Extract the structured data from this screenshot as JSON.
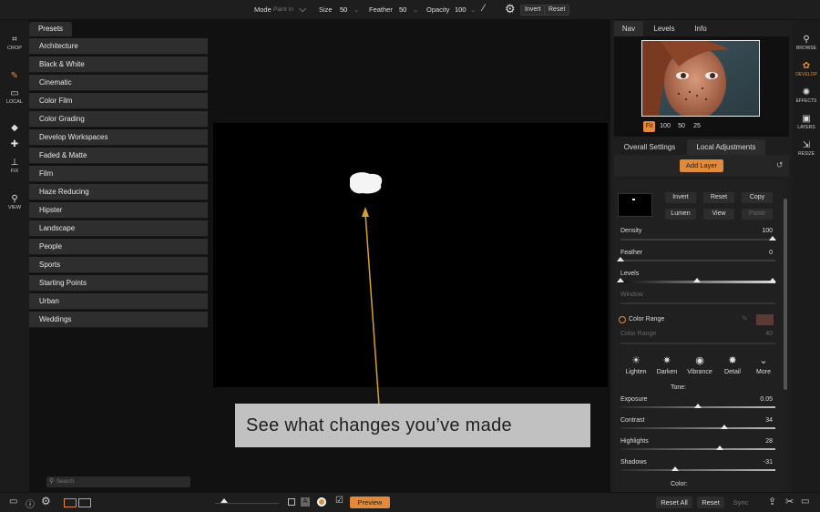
{
  "topbar": {
    "mode_label": "Mode",
    "mode_value": "Paint In",
    "size_label": "Size",
    "size_value": "50",
    "feather_label": "Feather",
    "feather_value": "50",
    "opacity_label": "Opacity",
    "opacity_value": "100",
    "invert_label": "Invert",
    "reset_label": "Reset"
  },
  "lefttools": [
    {
      "label": "CROP",
      "icon": "crop-icon",
      "glyph": "⌗"
    },
    {
      "label": "",
      "icon": "brush-icon",
      "glyph": "✎"
    },
    {
      "label": "LOCAL",
      "icon": "local-icon",
      "glyph": "▭"
    },
    {
      "label": "",
      "icon": "eraser-icon",
      "glyph": "◆"
    },
    {
      "label": "",
      "icon": "heal-icon",
      "glyph": "✚"
    },
    {
      "label": "FIX",
      "icon": "stamp-icon",
      "glyph": "⊥"
    },
    {
      "label": "VIEW",
      "icon": "magnifier-icon",
      "glyph": "⚲"
    }
  ],
  "presets": {
    "tab_label": "Presets",
    "items": [
      "Architecture",
      "Black & White",
      "Cinematic",
      "Color Film",
      "Color Grading",
      "Develop Workspaces",
      "Faded & Matte",
      "Film",
      "Haze Reducing",
      "Hipster",
      "Landscape",
      "People",
      "Sports",
      "Starting Points",
      "Urban",
      "Weddings"
    ],
    "search_placeholder": "Search"
  },
  "canvas": {
    "banner_text": "See what changes you’ve made",
    "arrow_color": "#d7a12a"
  },
  "rightpanel": {
    "tabs": [
      "Nav",
      "Levels",
      "Info"
    ],
    "zoom": [
      "Fit",
      "100",
      "50",
      "25"
    ],
    "subtabs": [
      "Overall Settings",
      "Local Adjustments"
    ],
    "add_layer": "Add Layer",
    "mask_buttons": [
      "Invert",
      "Reset",
      "Copy",
      "Lumen",
      "View",
      "Paste"
    ],
    "density_label": "Density",
    "density_value": "100",
    "feather_label": "Feather",
    "feather_value": "0",
    "levels_label": "Levels",
    "window_label": "Window",
    "color_range_label": "Color Range",
    "color_range_sub": "Color Range",
    "color_range_value": "40",
    "tools": [
      {
        "label": "Lighten",
        "icon": "sun-icon",
        "glyph": "☀"
      },
      {
        "label": "Darken",
        "icon": "dark-sun-icon",
        "glyph": "✷"
      },
      {
        "label": "Vibrance",
        "icon": "vibrance-icon",
        "glyph": "◉"
      },
      {
        "label": "Detail",
        "icon": "detail-icon",
        "glyph": "✸"
      },
      {
        "label": "More",
        "icon": "more-icon",
        "glyph": "⌄"
      }
    ],
    "tone_label": "Tone:",
    "sliders": [
      {
        "label": "Exposure",
        "value": "0.05",
        "level": 0.5
      },
      {
        "label": "Contrast",
        "value": "34",
        "level": 0.67
      },
      {
        "label": "Highlights",
        "value": "28",
        "level": 0.64
      },
      {
        "label": "Shadows",
        "value": "-31",
        "level": 0.35
      }
    ],
    "color_label": "Color:",
    "accent": "#e08a3a"
  },
  "righttools": [
    {
      "label": "BROWSE",
      "icon": "browse-icon",
      "glyph": "⚲"
    },
    {
      "label": "DEVELOP",
      "icon": "develop-icon",
      "glyph": "✿"
    },
    {
      "label": "EFFECTS",
      "icon": "effects-icon",
      "glyph": "✺"
    },
    {
      "label": "LAYERS",
      "icon": "layers-icon",
      "glyph": "▣"
    },
    {
      "label": "RESIZE",
      "icon": "resize-icon",
      "glyph": "⇲"
    }
  ],
  "bottombar": {
    "preview_label": "Preview",
    "reset_all_label": "Reset All",
    "reset_label": "Reset",
    "sync_label": "Sync"
  }
}
